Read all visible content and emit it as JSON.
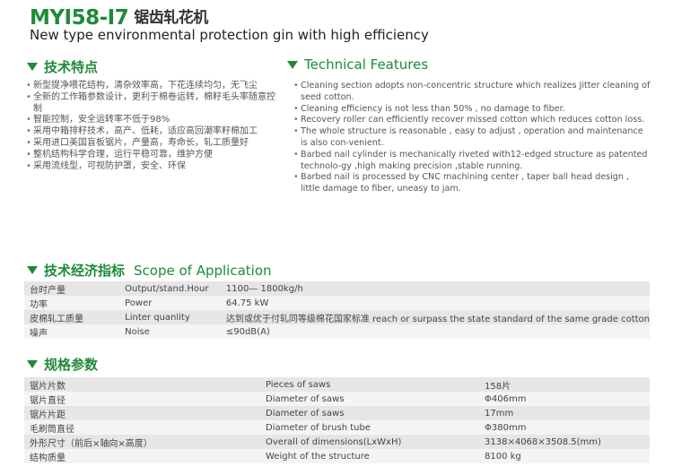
{
  "header": {
    "model": "MYI58-I7",
    "model_cn": "锯齿轧花机",
    "subtitle": "New type environmental protection gin with high efficiency"
  },
  "colors": {
    "accent": "#1f8a3a",
    "row_shade": "#e6e6e6",
    "row_light": "#f4f4f4"
  },
  "features_cn": {
    "title": "技术特点",
    "items": [
      "新型提净喂花结构，清杂效率高，下花连续均匀，无飞尘",
      "全新的工作箱参数设计，更利于棉卷运转，棉籽毛头率随意控制",
      "智能控制，安全运转率不低于98%",
      "采用中箱排籽技术，高产、低耗，适应高回潮率籽棉加工",
      "采用进口美国盲板锯片，产量高，寿命长，轧工质量好",
      "整机结构科学合理，运行平稳可靠，维护方便",
      "采用流线型，可视防护罩，安全、环保"
    ]
  },
  "features_en": {
    "title": "Technical Features",
    "items": [
      "Cleaning section adopts non-concentric structure which realizes Jitter cleaning of seed cotton.",
      "Cleaning efficiency is not less than 50% , no damage to fiber.",
      "Recovery roller can efficiently recover missed cotton which reduces cotton loss.",
      "The whole structure is reasonable , easy to adjust , operation and maintenance is also con-venient.",
      "Barbed nail cylinder is mechanically riveted with12-edged structure as patented technolo-gy ,high making precision ,stable running.",
      "Barbed nail is processed by CNC machining center , taper ball head design , little damage to fiber, uneasy to jam."
    ]
  },
  "scope": {
    "title_cn": "技术经济指标",
    "title_en": "Scope of Application",
    "rows": [
      {
        "cn": "台时产量",
        "en": "Output/stand.Hour",
        "value": "1100— 1800kg/h"
      },
      {
        "cn": "功率",
        "en": "Power",
        "value": "64.75 kW"
      },
      {
        "cn": "皮棉轧工质量",
        "en": "Linter quanlity",
        "value": "达到或优于付轧同等级棉花国家标准  reach or surpass the state standard of the same grade cotton"
      },
      {
        "cn": "噪声",
        "en": "Noise",
        "value": "≤90dB(A)"
      }
    ]
  },
  "specs": {
    "title": "规格参数",
    "rows": [
      {
        "cn": "锯片片数",
        "en": "Pieces of saws",
        "value": "158片"
      },
      {
        "cn": "锯片直径",
        "en": "Diameter of saws",
        "value": "Φ406mm"
      },
      {
        "cn": "锯片片距",
        "en": "Diameter of saws",
        "value": "17mm"
      },
      {
        "cn": "毛刷筒直径",
        "en": "Diameter of brush tube",
        "value": "Φ380mm"
      },
      {
        "cn": "外形尺寸（前后×轴向×高度）",
        "en": "Overall of dimensions(LxWxH)",
        "value": "3138×4068×3508.5(mm)"
      },
      {
        "cn": "结构质量",
        "en": "Weight of the structure",
        "value": "8100 kg"
      }
    ]
  }
}
